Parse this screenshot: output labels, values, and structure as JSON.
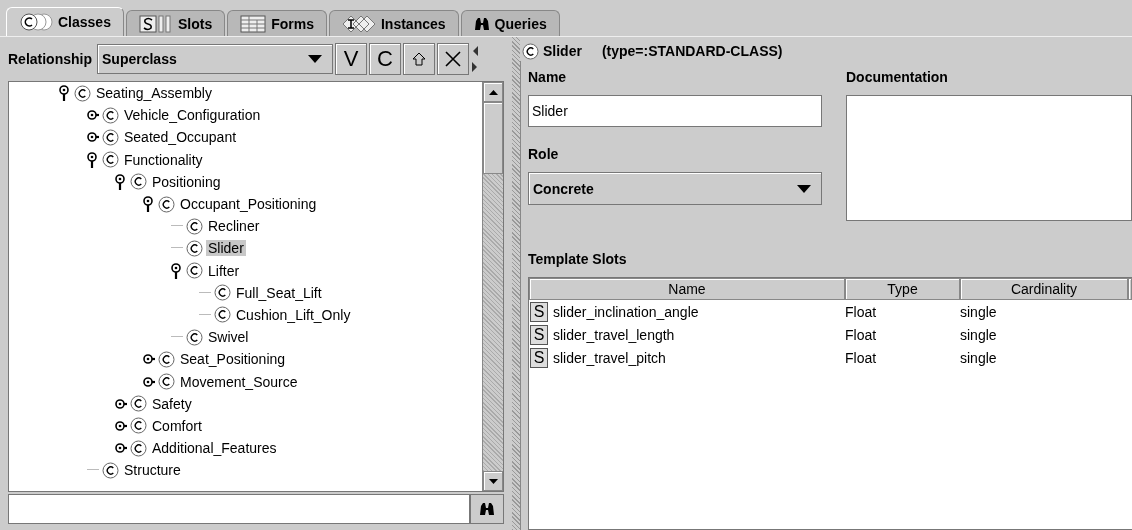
{
  "tabs": [
    {
      "label": "Classes",
      "kind": "classes",
      "selected": true
    },
    {
      "label": "Slots",
      "kind": "slots",
      "selected": false
    },
    {
      "label": "Forms",
      "kind": "forms",
      "selected": false
    },
    {
      "label": "Instances",
      "kind": "instances",
      "selected": false
    },
    {
      "label": "Queries",
      "kind": "queries",
      "selected": false
    }
  ],
  "left_panel": {
    "relationship_label": "Relationship",
    "relationship_value": "Superclass",
    "tool_buttons": [
      "V",
      "C"
    ],
    "tree": [
      {
        "name": "Seating_Assembly",
        "expanded": true,
        "selected": false,
        "children": [
          {
            "name": "Vehicle_Configuration",
            "expanded": false,
            "selected": false
          },
          {
            "name": "Seated_Occupant",
            "expanded": false,
            "selected": false
          },
          {
            "name": "Functionality",
            "expanded": true,
            "selected": false,
            "children": [
              {
                "name": "Positioning",
                "expanded": true,
                "selected": false,
                "children": [
                  {
                    "name": "Occupant_Positioning",
                    "expanded": true,
                    "selected": false,
                    "children": [
                      {
                        "name": "Recliner",
                        "selected": false
                      },
                      {
                        "name": "Slider",
                        "selected": true
                      },
                      {
                        "name": "Lifter",
                        "expanded": true,
                        "selected": false,
                        "children": [
                          {
                            "name": "Full_Seat_Lift",
                            "selected": false
                          },
                          {
                            "name": "Cushion_Lift_Only",
                            "selected": false
                          }
                        ]
                      },
                      {
                        "name": "Swivel",
                        "selected": false
                      }
                    ]
                  },
                  {
                    "name": "Seat_Positioning",
                    "expanded": false,
                    "selected": false
                  },
                  {
                    "name": "Movement_Source",
                    "expanded": false,
                    "selected": false
                  }
                ]
              },
              {
                "name": "Safety",
                "expanded": false,
                "selected": false
              },
              {
                "name": "Comfort",
                "expanded": false,
                "selected": false
              },
              {
                "name": "Additional_Features",
                "expanded": false,
                "selected": false
              }
            ]
          },
          {
            "name": "Structure",
            "selected": false
          }
        ]
      }
    ]
  },
  "right_panel": {
    "class_name": "Slider",
    "class_type": "(type=:STANDARD-CLASS)",
    "name_label": "Name",
    "name_value": "Slider",
    "role_label": "Role",
    "role_value": "Concrete",
    "documentation_label": "Documentation",
    "template_slots_label": "Template Slots",
    "table": {
      "columns": [
        "Name",
        "Type",
        "Cardinality"
      ],
      "rows": [
        {
          "icon": "S",
          "name": "slider_inclination_angle",
          "type": "Float",
          "cardinality": "single"
        },
        {
          "icon": "S",
          "name": "slider_travel_length",
          "type": "Float",
          "cardinality": "single"
        },
        {
          "icon": "S",
          "name": "slider_travel_pitch",
          "type": "Float",
          "cardinality": "single"
        }
      ]
    }
  }
}
